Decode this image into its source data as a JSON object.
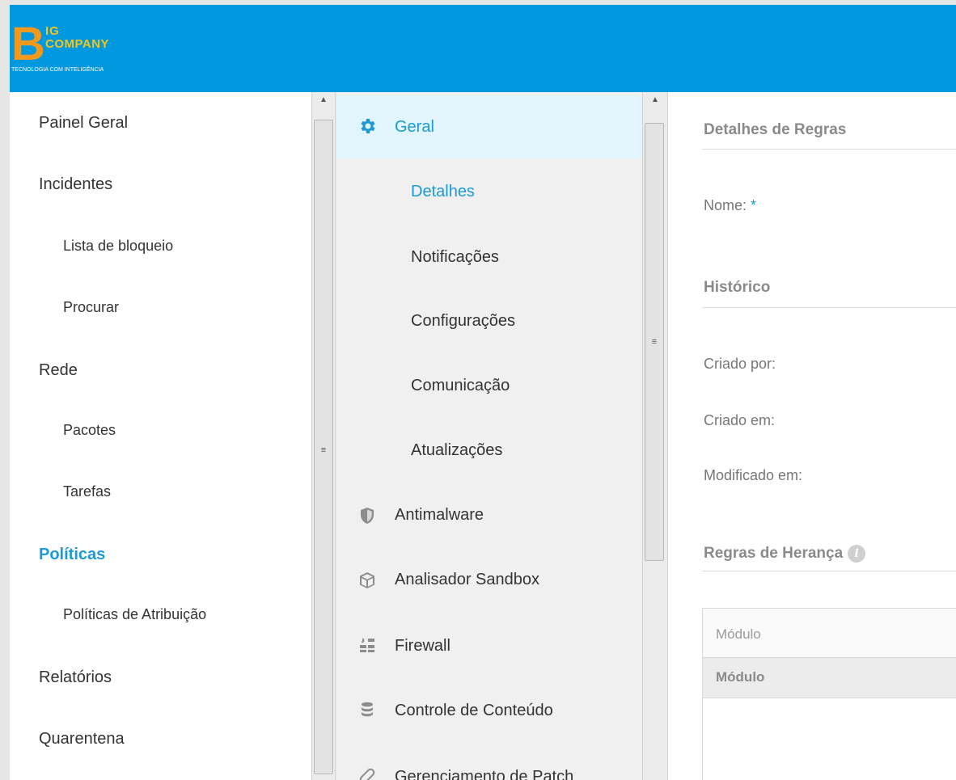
{
  "header": {
    "logo": {
      "letter": "B",
      "line1": "IG",
      "line2": "COMPANY",
      "tagline": "TECNOLOGIA COM INTELIGÊNCIA"
    }
  },
  "left_nav": {
    "items": [
      {
        "label": "Painel Geral",
        "level": 0
      },
      {
        "label": "Incidentes",
        "level": 0
      },
      {
        "label": "Lista de bloqueio",
        "level": 1
      },
      {
        "label": "Procurar",
        "level": 1
      },
      {
        "label": "Rede",
        "level": 0
      },
      {
        "label": "Pacotes",
        "level": 1
      },
      {
        "label": "Tarefas",
        "level": 1
      },
      {
        "label": "Políticas",
        "level": 0,
        "active": true
      },
      {
        "label": "Políticas de Atribuição",
        "level": 1
      },
      {
        "label": "Relatórios",
        "level": 0
      },
      {
        "label": "Quarentena",
        "level": 0
      }
    ]
  },
  "policy_menu": {
    "general": {
      "label": "Geral",
      "icon": "gear-icon"
    },
    "general_subitems": [
      {
        "label": "Detalhes",
        "active": true
      },
      {
        "label": "Notificações"
      },
      {
        "label": "Configurações"
      },
      {
        "label": "Comunicação"
      },
      {
        "label": "Atualizações"
      }
    ],
    "modules": [
      {
        "label": "Antimalware",
        "icon": "shield-icon"
      },
      {
        "label": "Analisador Sandbox",
        "icon": "cube-icon"
      },
      {
        "label": "Firewall",
        "icon": "firewall-icon"
      },
      {
        "label": "Controle de Conteúdo",
        "icon": "database-icon"
      },
      {
        "label": "Gerenciamento de Patch",
        "icon": "bandage-icon"
      }
    ]
  },
  "details": {
    "rules_title": "Detalhes de Regras",
    "name_label": "Nome:",
    "required_mark": "*",
    "history_title": "Histórico",
    "created_by_label": "Criado por:",
    "created_on_label": "Criado em:",
    "modified_on_label": "Modificado em:",
    "inheritance_title": "Regras de Herança",
    "table": {
      "filter_placeholder": "Módulo",
      "column_header": "Módulo"
    }
  },
  "colors": {
    "header": "#0098de",
    "accent": "#1b9ad6",
    "active_row": "#e2f4fc"
  }
}
